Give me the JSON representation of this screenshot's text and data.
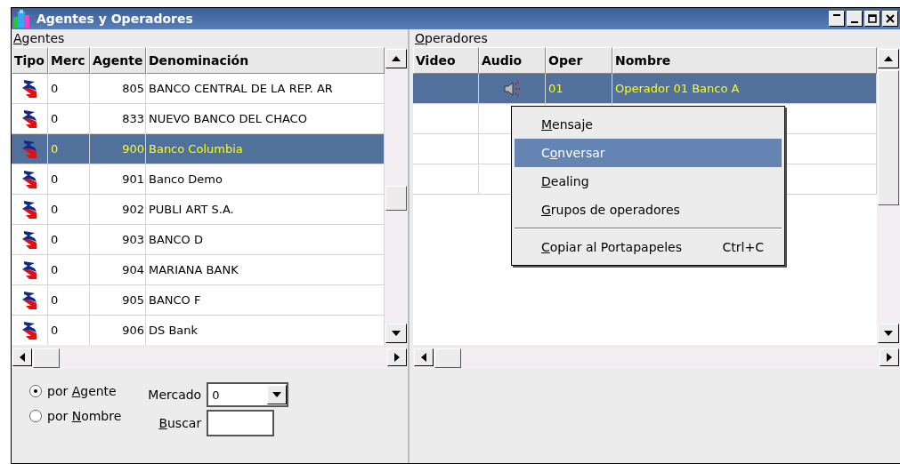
{
  "window": {
    "title": "Agentes y Operadores"
  },
  "agentes": {
    "label": "Agentes",
    "columns": [
      "Tipo",
      "Merc",
      "Agente",
      "Denominación"
    ],
    "rows": [
      {
        "merc": "0",
        "agente": "805",
        "name": "BANCO CENTRAL DE LA REP. AR",
        "selected": false
      },
      {
        "merc": "0",
        "agente": "833",
        "name": "NUEVO BANCO DEL CHACO",
        "selected": false
      },
      {
        "merc": "0",
        "agente": "900",
        "name": "Banco Columbia",
        "selected": true
      },
      {
        "merc": "0",
        "agente": "901",
        "name": "Banco Demo",
        "selected": false
      },
      {
        "merc": "0",
        "agente": "902",
        "name": "PUBLI ART S.A.",
        "selected": false
      },
      {
        "merc": "0",
        "agente": "903",
        "name": "BANCO D",
        "selected": false
      },
      {
        "merc": "0",
        "agente": "904",
        "name": "MARIANA BANK",
        "selected": false
      },
      {
        "merc": "0",
        "agente": "905",
        "name": "BANCO F",
        "selected": false
      },
      {
        "merc": "0",
        "agente": "906",
        "name": "DS Bank",
        "selected": false
      }
    ]
  },
  "operadores": {
    "label": "Operadores",
    "columns": [
      "Video",
      "Audio",
      "Oper",
      "Nombre"
    ],
    "rows": [
      {
        "audio": true,
        "oper": "01",
        "name": "Operador 01 Banco A",
        "selected": true
      }
    ]
  },
  "context_menu": [
    {
      "kind": "item",
      "label": "Mensaje",
      "selected": false
    },
    {
      "kind": "item",
      "label": "Conversar",
      "selected": true
    },
    {
      "kind": "item",
      "label": "Dealing",
      "selected": false
    },
    {
      "kind": "item",
      "label": "Grupos de operadores",
      "selected": false
    },
    {
      "kind": "separator"
    },
    {
      "kind": "item",
      "label": "Copiar al Portapapeles",
      "shortcut": "Ctrl+C",
      "selected": false
    }
  ],
  "search_mode": [
    {
      "label": "por Agente",
      "selected": true
    },
    {
      "label": "por Nombre",
      "selected": false
    }
  ],
  "mercado": {
    "label": "Mercado",
    "value": "0"
  },
  "buscar": {
    "label": "Buscar"
  }
}
